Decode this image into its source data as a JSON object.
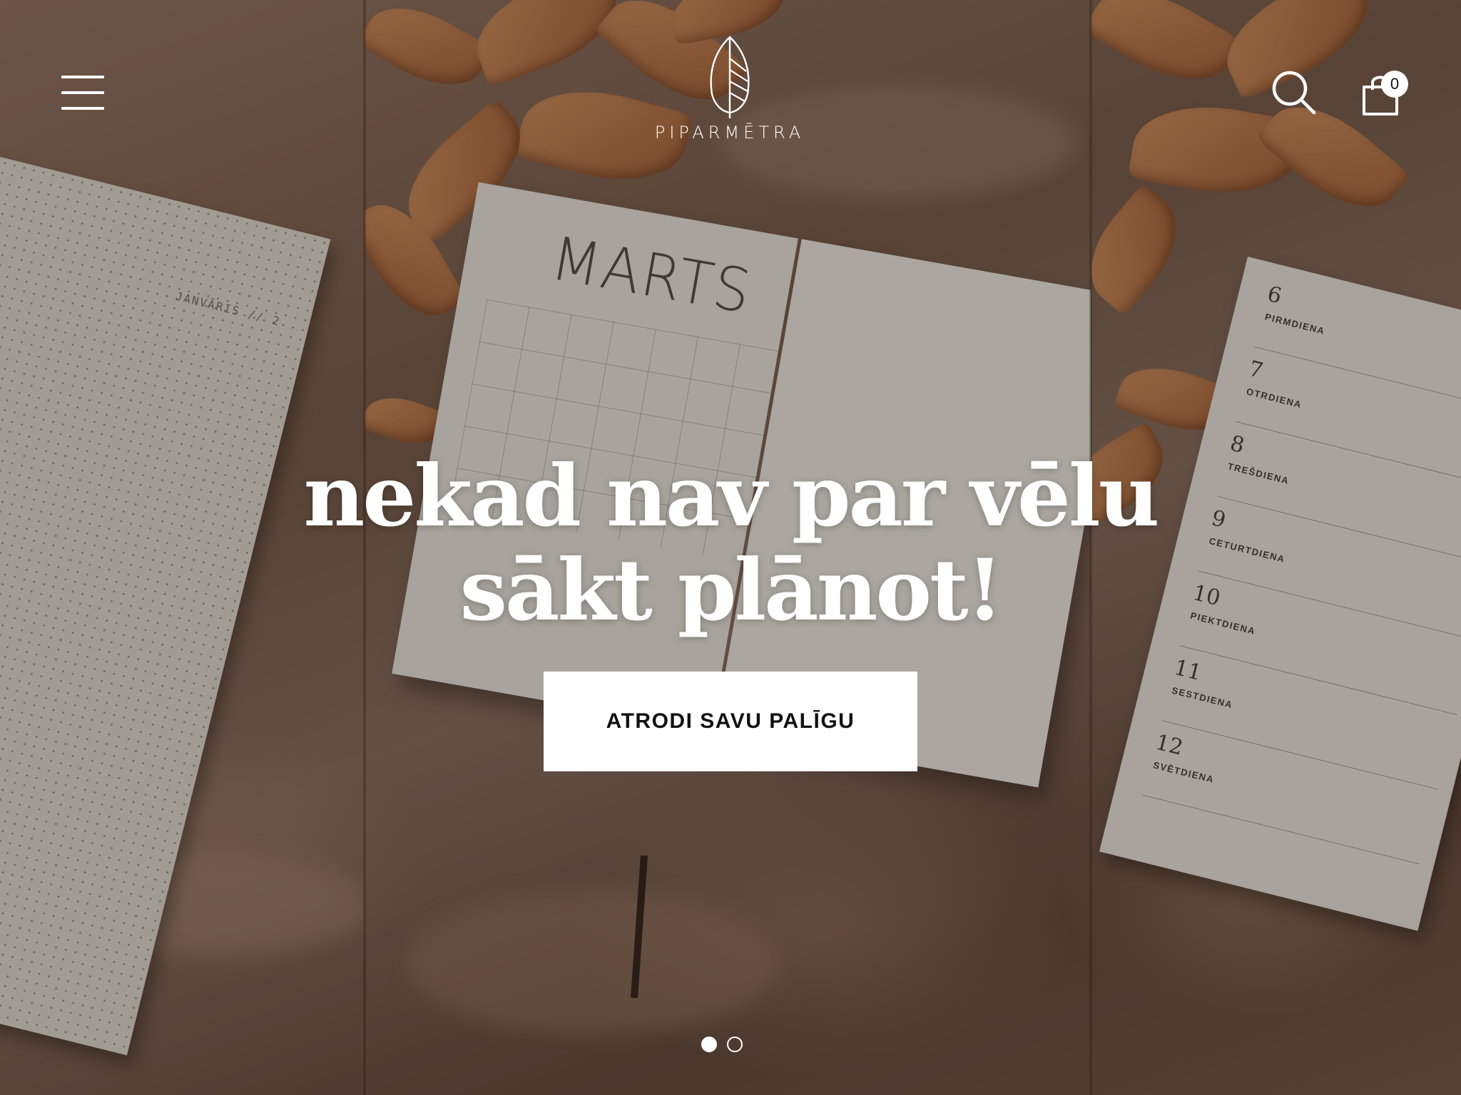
{
  "header": {
    "brand_name": "PIPARMĒTRA",
    "cart_count": "0"
  },
  "hero": {
    "title_line1": "nekad nav par vēlu",
    "title_line2": "sākt plānot!",
    "cta_label": "ATRODI SAVU PALĪGU"
  },
  "background_photo": {
    "left_notebook_label": "JANVĀRIS // 2",
    "planner_month": "MARTS",
    "week_days": [
      {
        "num": "6",
        "name": "PIRMDIENA"
      },
      {
        "num": "7",
        "name": "OTRDIENA"
      },
      {
        "num": "8",
        "name": "TREŠDIENA"
      },
      {
        "num": "9",
        "name": "CETURTDIENA"
      },
      {
        "num": "10",
        "name": "PIEKTDIENA"
      },
      {
        "num": "11",
        "name": "SESTDIENA"
      },
      {
        "num": "12",
        "name": "SVĒTDIENA"
      }
    ]
  },
  "slider": {
    "slide_count": 2,
    "active_index": 0
  },
  "icons": {
    "menu": "hamburger-menu-icon",
    "logo": "leaf-logo-icon",
    "search": "search-icon",
    "cart": "shopping-bag-icon"
  },
  "colors": {
    "overlay_text": "#ffffff",
    "cta_background": "#ffffff",
    "cta_text": "#111111"
  }
}
